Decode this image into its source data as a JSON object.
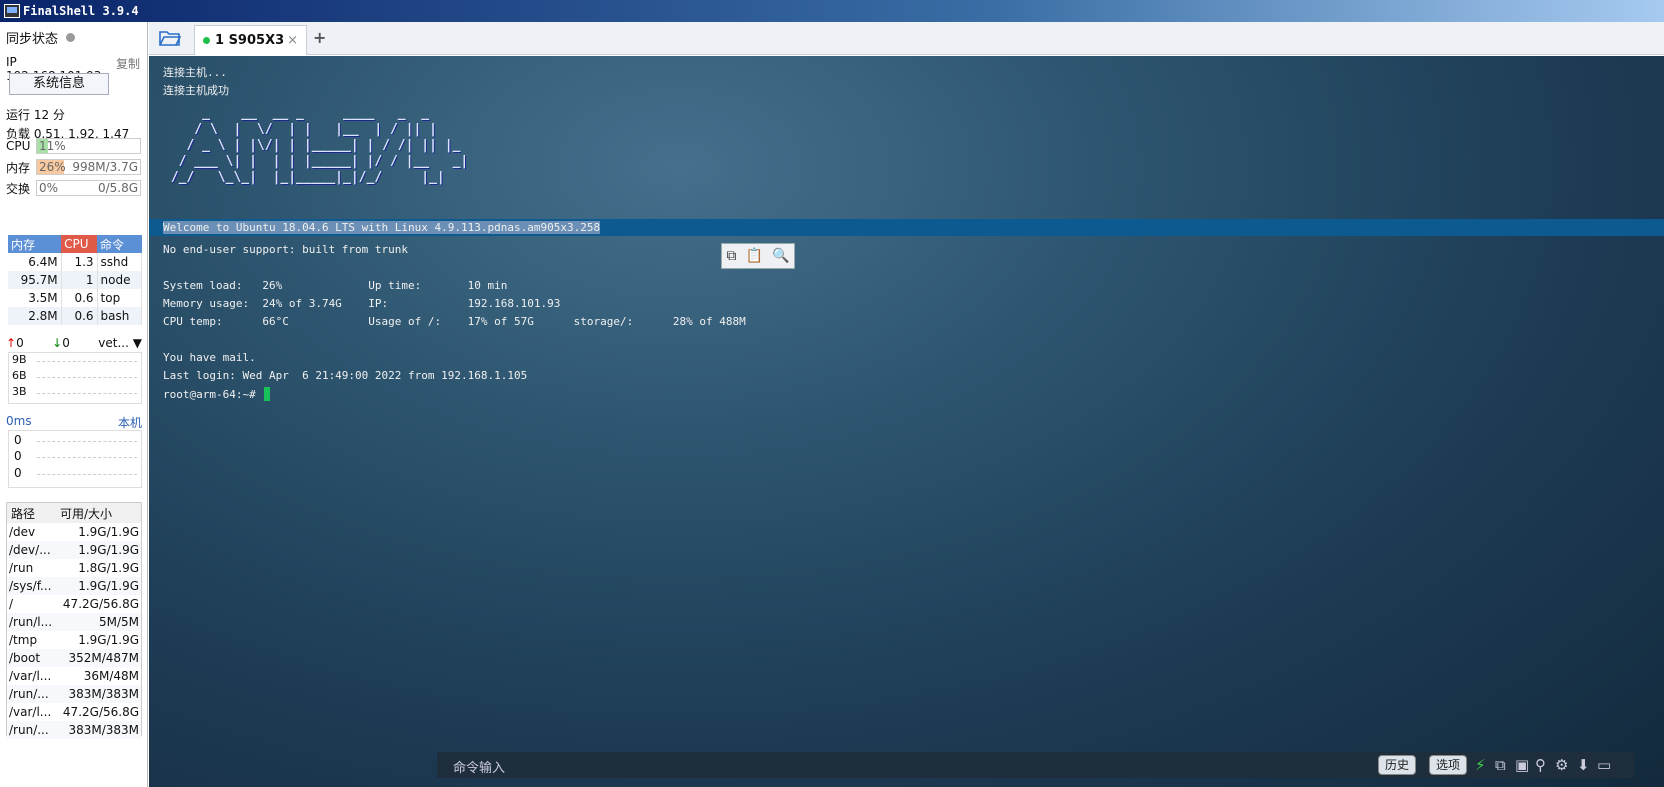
{
  "window": {
    "title": "FinalShell 3.9.4"
  },
  "sidebar": {
    "sync_label": "同步状态",
    "ip_text": "IP 192.168.101.93",
    "copy_label": "复制",
    "sysinfo_button": "系统信息",
    "uptime": "运行 12 分",
    "load": "负载 0.51, 1.92, 1.47",
    "cpu": {
      "label": "CPU",
      "value": "11%",
      "percent": 11
    },
    "mem": {
      "label": "内存",
      "value": "26%",
      "detail": "998M/3.7G",
      "percent": 26
    },
    "swap": {
      "label": "交换",
      "value": "0%",
      "detail": "0/5.8G",
      "percent": 0
    },
    "process_table": {
      "headers": [
        "内存",
        "CPU",
        "命令"
      ],
      "rows": [
        {
          "mem": "6.4M",
          "cpu": "1.3",
          "cmd": "sshd"
        },
        {
          "mem": "95.7M",
          "cpu": "1",
          "cmd": "node"
        },
        {
          "mem": "3.5M",
          "cpu": "0.6",
          "cmd": "top"
        },
        {
          "mem": "2.8M",
          "cpu": "0.6",
          "cmd": "bash"
        }
      ]
    },
    "net": {
      "up": "0",
      "down": "0",
      "iface": "vet...",
      "y_labels": [
        "9B",
        "6B",
        "3B"
      ]
    },
    "ping": {
      "latency": "0ms",
      "target": "本机",
      "y_labels": [
        "0",
        "0",
        "0"
      ]
    },
    "disk_table": {
      "headers": [
        "路径",
        "可用/大小"
      ],
      "rows": [
        {
          "path": "/dev",
          "size": "1.9G/1.9G"
        },
        {
          "path": "/dev/...",
          "size": "1.9G/1.9G"
        },
        {
          "path": "/run",
          "size": "1.8G/1.9G"
        },
        {
          "path": "/sys/f...",
          "size": "1.9G/1.9G"
        },
        {
          "path": "/",
          "size": "47.2G/56.8G"
        },
        {
          "path": "/run/l...",
          "size": "5M/5M"
        },
        {
          "path": "/tmp",
          "size": "1.9G/1.9G"
        },
        {
          "path": "/boot",
          "size": "352M/487M"
        },
        {
          "path": "/var/l...",
          "size": "36M/48M"
        },
        {
          "path": "/run/...",
          "size": "383M/383M"
        },
        {
          "path": "/var/l...",
          "size": "47.2G/56.8G"
        },
        {
          "path": "/run/...",
          "size": "383M/383M"
        }
      ]
    }
  },
  "tabs": {
    "session_label": "1 S905X3",
    "close": "×",
    "add": "+"
  },
  "terminal": {
    "line_connect": "连接主机...",
    "line_connected": "连接主机成功",
    "ascii_art": "     _    __  __ _     ____   _  _\n    / \\  |  \\/  | |   |__  | / || |\n   / _ \\ | |\\/| | |_____| | / /| || |_\n  / ___ \\| |  | | |_____| |/ / |__   _|\n /_/   \\_\\_|  |_|_____|_|/_/     |_|",
    "welcome": "Welcome to Ubuntu 18.04.6 LTS with Linux 4.9.113.pdnas.am905x3.258",
    "support": "No end-user support: built from trunk",
    "sysinfo_line1": "System load:   26%             Up time:       10 min",
    "sysinfo_line2": "Memory usage:  24% of 3.74G    IP:            192.168.101.93",
    "sysinfo_line3": "CPU temp:      66°C            Usage of /:    17% of 57G      storage/:      28% of 488M",
    "mail": "You have mail.",
    "last_login": "Last login: Wed Apr  6 21:49:00 2022 from 192.168.1.105",
    "prompt": "root@arm-64:~#"
  },
  "cmdbar": {
    "placeholder": "命令输入",
    "history": "历史",
    "options": "选项"
  },
  "colors": {
    "cpu_fill": "#a8e0a8",
    "mem_fill": "#f8c9a0",
    "head_mem": "#5b8fd6",
    "head_cpu": "#e05a4a",
    "head_cmd": "#5b8fd6"
  }
}
